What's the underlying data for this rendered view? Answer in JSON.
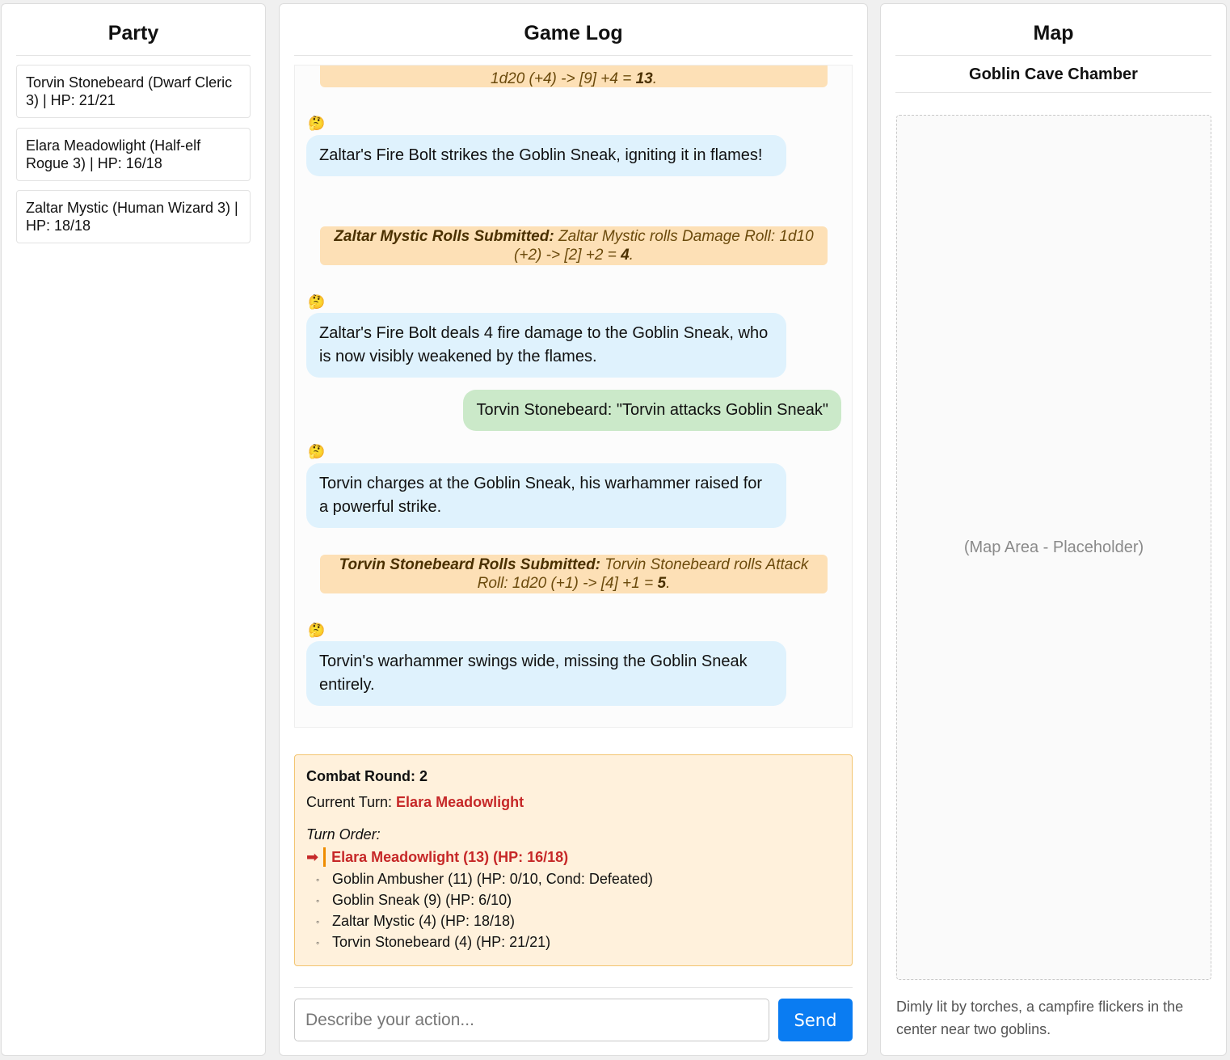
{
  "party": {
    "title": "Party",
    "members": [
      "Torvin Stonebeard (Dwarf Cleric 3) | HP: 21/21",
      "Elara Meadowlight (Half-elf Rogue 3) | HP: 16/18",
      "Zaltar Mystic (Human Wizard 3) | HP: 18/18"
    ]
  },
  "game_log": {
    "title": "Game Log",
    "messages": {
      "roll0_line2": "1d20 (+4) -> [9] +4 = ",
      "roll0_total": "13",
      "narr1": "Zaltar's Fire Bolt strikes the Goblin Sneak, igniting it in flames!",
      "roll1_prefix": "Zaltar Mystic Rolls Submitted:",
      "roll1_text": "Zaltar Mystic rolls Damage Roll: 1d10 (+2) -> [2] +2 = ",
      "roll1_total": "4",
      "narr2": "Zaltar's Fire Bolt deals 4 fire damage to the Goblin Sneak, who is now visibly weakened by the flames.",
      "user1": "Torvin Stonebeard: \"Torvin attacks Goblin Sneak\"",
      "narr3": "Torvin charges at the Goblin Sneak, his warhammer raised for a powerful strike.",
      "roll2_prefix": "Torvin Stonebeard Rolls Submitted:",
      "roll2_text": "Torvin Stonebeard rolls Attack Roll: 1d20 (+1) -> [4] +1 = ",
      "roll2_total": "5",
      "narr4": "Torvin's warhammer swings wide, missing the Goblin Sneak entirely."
    },
    "narrator_emoji": "🤔"
  },
  "combat": {
    "round_label": "Combat Round: 2",
    "current_turn_label": "Current Turn: ",
    "current_turn_name": "Elara Meadowlight",
    "order_label": "Turn Order:",
    "active_entry": "Elara Meadowlight (13) (HP: 16/18)",
    "entries": [
      "Goblin Ambusher (11) (HP: 0/10, Cond: Defeated)",
      "Goblin Sneak (9) (HP: 6/10)",
      "Zaltar Mystic (4) (HP: 18/18)",
      "Torvin Stonebeard (4) (HP: 21/21)"
    ]
  },
  "input": {
    "placeholder": "Describe your action...",
    "send_label": "Send"
  },
  "map": {
    "title": "Map",
    "location": "Goblin Cave Chamber",
    "placeholder": "(Map Area - Placeholder)",
    "description": "Dimly lit by torches, a campfire flickers in the center near two goblins."
  }
}
